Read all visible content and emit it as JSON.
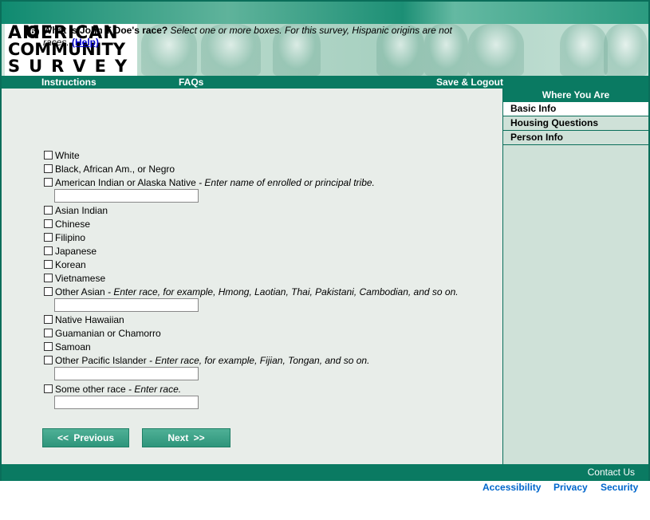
{
  "logo": {
    "line1": "AMERICAN",
    "line2": "COMMUNITY",
    "line3": "SURVEY"
  },
  "nav": {
    "instructions": "Instructions",
    "faqs": "FAQs",
    "save_logout": "Save & Logout"
  },
  "sidebar": {
    "title": "Where You Are",
    "items": [
      "Basic Info",
      "Housing Questions",
      "Person Info"
    ]
  },
  "question": {
    "number": "6",
    "text_bold": "What is John T Doe's race?",
    "text_italic": " Select one or more boxes. For this survey, Hispanic origins are not races. ",
    "help": "(Help)"
  },
  "options": {
    "white": {
      "label": "White"
    },
    "black": {
      "label": "Black, African Am., or Negro"
    },
    "amind": {
      "label": "American Indian or Alaska Native",
      "instr": " - Enter name of enrolled or principal tribe."
    },
    "asianindian": {
      "label": "Asian Indian"
    },
    "chinese": {
      "label": "Chinese"
    },
    "filipino": {
      "label": "Filipino"
    },
    "japanese": {
      "label": "Japanese"
    },
    "korean": {
      "label": "Korean"
    },
    "vietnamese": {
      "label": "Vietnamese"
    },
    "otherasian": {
      "label": "Other Asian",
      "instr": " - Enter race, for example, Hmong, Laotian, Thai, Pakistani, Cambodian, and so on."
    },
    "hawaiian": {
      "label": "Native Hawaiian"
    },
    "guamanian": {
      "label": "Guamanian or Chamorro"
    },
    "samoan": {
      "label": "Samoan"
    },
    "otherpacific": {
      "label": "Other Pacific Islander",
      "instr": " - Enter race, for example, Fijian, Tongan, and so on."
    },
    "other": {
      "label": "Some other race",
      "instr": " - Enter race."
    }
  },
  "buttons": {
    "previous": "<<   Previous",
    "next": "Next   >>"
  },
  "footer": {
    "contact": "Contact Us"
  },
  "bottom_links": [
    "Accessibility",
    "Privacy",
    "Security"
  ],
  "colors": {
    "brand_green": "#0a7a62",
    "panel": "#e8ede9",
    "sidebar": "#cfe1d8",
    "link_blue": "#0066cc"
  }
}
